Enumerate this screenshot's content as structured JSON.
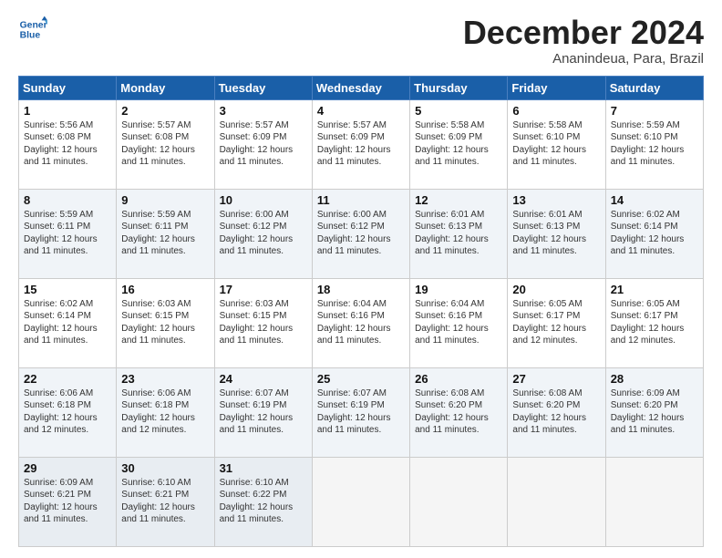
{
  "header": {
    "logo_line1": "General",
    "logo_line2": "Blue",
    "month_title": "December 2024",
    "location": "Ananindeua, Para, Brazil"
  },
  "days_of_week": [
    "Sunday",
    "Monday",
    "Tuesday",
    "Wednesday",
    "Thursday",
    "Friday",
    "Saturday"
  ],
  "weeks": [
    [
      {
        "day": "1",
        "sunrise": "5:56 AM",
        "sunset": "6:08 PM",
        "daylight": "12 hours and 11 minutes."
      },
      {
        "day": "2",
        "sunrise": "5:57 AM",
        "sunset": "6:08 PM",
        "daylight": "12 hours and 11 minutes."
      },
      {
        "day": "3",
        "sunrise": "5:57 AM",
        "sunset": "6:09 PM",
        "daylight": "12 hours and 11 minutes."
      },
      {
        "day": "4",
        "sunrise": "5:57 AM",
        "sunset": "6:09 PM",
        "daylight": "12 hours and 11 minutes."
      },
      {
        "day": "5",
        "sunrise": "5:58 AM",
        "sunset": "6:09 PM",
        "daylight": "12 hours and 11 minutes."
      },
      {
        "day": "6",
        "sunrise": "5:58 AM",
        "sunset": "6:10 PM",
        "daylight": "12 hours and 11 minutes."
      },
      {
        "day": "7",
        "sunrise": "5:59 AM",
        "sunset": "6:10 PM",
        "daylight": "12 hours and 11 minutes."
      }
    ],
    [
      {
        "day": "8",
        "sunrise": "5:59 AM",
        "sunset": "6:11 PM",
        "daylight": "12 hours and 11 minutes."
      },
      {
        "day": "9",
        "sunrise": "5:59 AM",
        "sunset": "6:11 PM",
        "daylight": "12 hours and 11 minutes."
      },
      {
        "day": "10",
        "sunrise": "6:00 AM",
        "sunset": "6:12 PM",
        "daylight": "12 hours and 11 minutes."
      },
      {
        "day": "11",
        "sunrise": "6:00 AM",
        "sunset": "6:12 PM",
        "daylight": "12 hours and 11 minutes."
      },
      {
        "day": "12",
        "sunrise": "6:01 AM",
        "sunset": "6:13 PM",
        "daylight": "12 hours and 11 minutes."
      },
      {
        "day": "13",
        "sunrise": "6:01 AM",
        "sunset": "6:13 PM",
        "daylight": "12 hours and 11 minutes."
      },
      {
        "day": "14",
        "sunrise": "6:02 AM",
        "sunset": "6:14 PM",
        "daylight": "12 hours and 11 minutes."
      }
    ],
    [
      {
        "day": "15",
        "sunrise": "6:02 AM",
        "sunset": "6:14 PM",
        "daylight": "12 hours and 11 minutes."
      },
      {
        "day": "16",
        "sunrise": "6:03 AM",
        "sunset": "6:15 PM",
        "daylight": "12 hours and 11 minutes."
      },
      {
        "day": "17",
        "sunrise": "6:03 AM",
        "sunset": "6:15 PM",
        "daylight": "12 hours and 11 minutes."
      },
      {
        "day": "18",
        "sunrise": "6:04 AM",
        "sunset": "6:16 PM",
        "daylight": "12 hours and 11 minutes."
      },
      {
        "day": "19",
        "sunrise": "6:04 AM",
        "sunset": "6:16 PM",
        "daylight": "12 hours and 11 minutes."
      },
      {
        "day": "20",
        "sunrise": "6:05 AM",
        "sunset": "6:17 PM",
        "daylight": "12 hours and 12 minutes."
      },
      {
        "day": "21",
        "sunrise": "6:05 AM",
        "sunset": "6:17 PM",
        "daylight": "12 hours and 12 minutes."
      }
    ],
    [
      {
        "day": "22",
        "sunrise": "6:06 AM",
        "sunset": "6:18 PM",
        "daylight": "12 hours and 12 minutes."
      },
      {
        "day": "23",
        "sunrise": "6:06 AM",
        "sunset": "6:18 PM",
        "daylight": "12 hours and 12 minutes."
      },
      {
        "day": "24",
        "sunrise": "6:07 AM",
        "sunset": "6:19 PM",
        "daylight": "12 hours and 11 minutes."
      },
      {
        "day": "25",
        "sunrise": "6:07 AM",
        "sunset": "6:19 PM",
        "daylight": "12 hours and 11 minutes."
      },
      {
        "day": "26",
        "sunrise": "6:08 AM",
        "sunset": "6:20 PM",
        "daylight": "12 hours and 11 minutes."
      },
      {
        "day": "27",
        "sunrise": "6:08 AM",
        "sunset": "6:20 PM",
        "daylight": "12 hours and 11 minutes."
      },
      {
        "day": "28",
        "sunrise": "6:09 AM",
        "sunset": "6:20 PM",
        "daylight": "12 hours and 11 minutes."
      }
    ],
    [
      {
        "day": "29",
        "sunrise": "6:09 AM",
        "sunset": "6:21 PM",
        "daylight": "12 hours and 11 minutes."
      },
      {
        "day": "30",
        "sunrise": "6:10 AM",
        "sunset": "6:21 PM",
        "daylight": "12 hours and 11 minutes."
      },
      {
        "day": "31",
        "sunrise": "6:10 AM",
        "sunset": "6:22 PM",
        "daylight": "12 hours and 11 minutes."
      },
      null,
      null,
      null,
      null
    ]
  ]
}
